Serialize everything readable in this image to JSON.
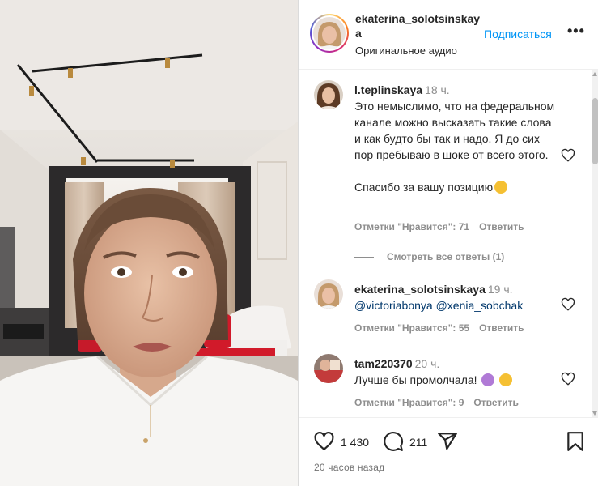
{
  "post": {
    "author": "ekaterina_solotsinskaya",
    "audio": "Оригинальное аудио",
    "follow_label": "Подписаться",
    "more_label": "•••"
  },
  "comments": [
    {
      "user": "l.teplinskaya",
      "time": "18 ч.",
      "text": "Это немыслимо, что на федеральном канале можно высказать такие слова и как будто бы так и надо. Я до сих пор пребываю в шоке от всего этого.\n\nСпасибо за вашу позицию",
      "likes": "Отметки \"Нравится\": 71",
      "reply_label": "Ответить",
      "emoji": "clapping-hands-emoji"
    },
    {
      "user": "ekaterina_solotsinskaya",
      "time": "19 ч.",
      "mention_1": "@victoriabonya",
      "mention_2": "@xenia_sobchak",
      "likes": "Отметки \"Нравится\": 55",
      "reply_label": "Ответить"
    },
    {
      "user": "tam220370",
      "time": "20 ч.",
      "text": "Лучше бы промолчала!",
      "likes": "Отметки \"Нравится\": 9",
      "reply_label": "Ответить",
      "emojis": [
        "woman-facepalming-emoji",
        "tears-of-joy-emoji"
      ]
    }
  ],
  "see_replies": "Смотреть все ответы (1)",
  "actions": {
    "likes_count": "1 430",
    "comments_count": "211",
    "icons": [
      "heart-icon",
      "comment-icon",
      "share-icon",
      "bookmark-icon"
    ]
  },
  "posted_time": "20 часов назад",
  "colors": {
    "link_blue": "#0095f6",
    "mention_blue": "#00376b",
    "muted_gray": "#8e8e8e",
    "text": "#262626"
  }
}
